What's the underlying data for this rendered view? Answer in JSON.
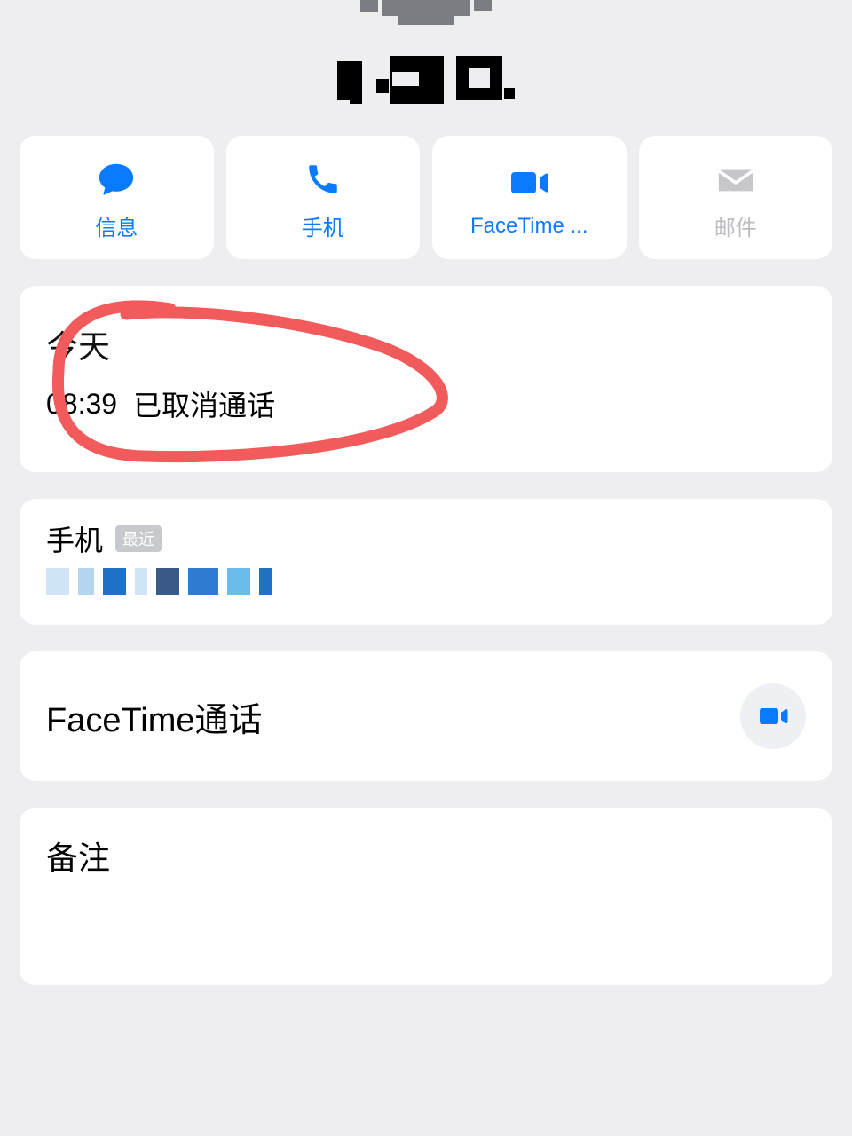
{
  "contact": {
    "name_redacted": true
  },
  "actions": [
    {
      "label": "信息",
      "icon": "message-icon",
      "enabled": true
    },
    {
      "label": "手机",
      "icon": "phone-icon",
      "enabled": true
    },
    {
      "label": "FaceTime ...",
      "icon": "video-icon",
      "enabled": true
    },
    {
      "label": "邮件",
      "icon": "mail-icon",
      "enabled": false
    }
  ],
  "call_log": {
    "day_label": "今天",
    "entries": [
      {
        "time": "08:39",
        "status": "已取消通话"
      }
    ]
  },
  "phone": {
    "type_label": "手机",
    "badge": "最近",
    "number_redacted": true
  },
  "facetime": {
    "label": "FaceTime通话"
  },
  "notes": {
    "label": "备注"
  },
  "colors": {
    "accent": "#0a7bff",
    "bg": "#eeeef1",
    "card": "#ffffff",
    "annotation": "#f25b5b"
  }
}
